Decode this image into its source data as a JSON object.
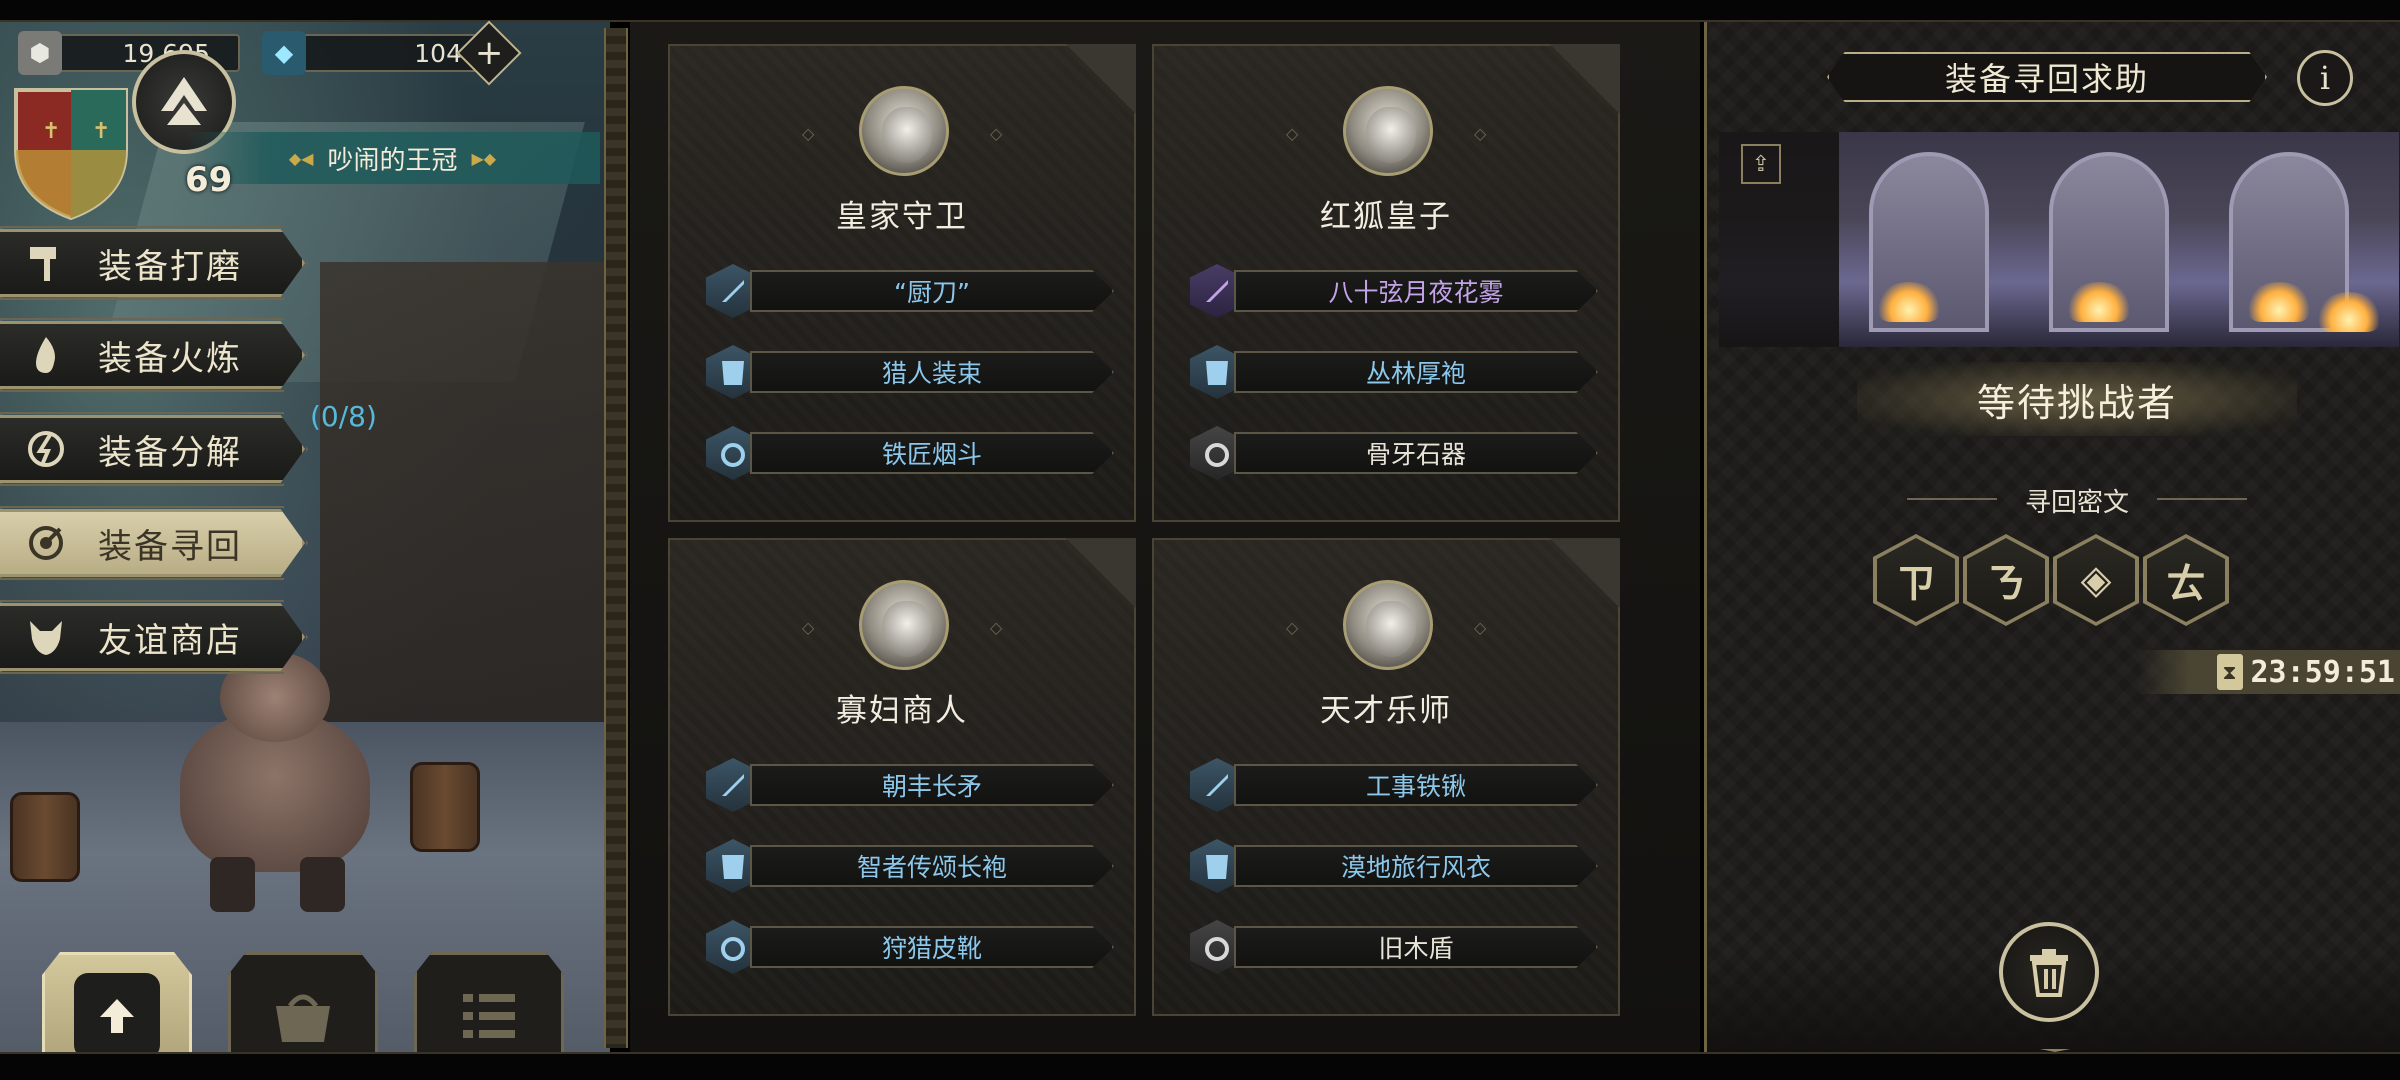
{
  "resources": {
    "stone": {
      "icon": "stone-icon",
      "value": "19,695"
    },
    "gem": {
      "icon": "gem-icon",
      "value": "104"
    }
  },
  "player": {
    "level": "69",
    "location": "吵闹的王冠"
  },
  "menu": {
    "items": [
      {
        "label": "装备打磨",
        "icon": "hammer-icon"
      },
      {
        "label": "装备火炼",
        "icon": "flame-icon"
      },
      {
        "label": "装备分解",
        "icon": "decompose-icon"
      },
      {
        "label": "装备寻回",
        "icon": "retrieve-icon"
      },
      {
        "label": "友谊商店",
        "icon": "fox-icon"
      }
    ],
    "active_index": 3,
    "decompose_count": "(0/8)"
  },
  "cards": [
    {
      "name": "皇家守卫",
      "items": [
        {
          "name": "“厨刀”",
          "slot": "sword-icon",
          "rarity": "blue"
        },
        {
          "name": "猎人装束",
          "slot": "armor-icon",
          "rarity": "blue"
        },
        {
          "name": "铁匠烟斗",
          "slot": "ring-icon",
          "rarity": "blue"
        }
      ]
    },
    {
      "name": "红狐皇子",
      "items": [
        {
          "name": "八十弦月夜花雾",
          "slot": "sword-icon",
          "rarity": "purple"
        },
        {
          "name": "丛林厚袍",
          "slot": "armor-icon",
          "rarity": "blue"
        },
        {
          "name": "骨牙石器",
          "slot": "ring-icon",
          "rarity": "white"
        }
      ]
    },
    {
      "name": "寡妇商人",
      "items": [
        {
          "name": "朝丰长矛",
          "slot": "sword-icon",
          "rarity": "blue"
        },
        {
          "name": "智者传颂长袍",
          "slot": "armor-icon",
          "rarity": "blue"
        },
        {
          "name": "狩猎皮靴",
          "slot": "ring-icon",
          "rarity": "blue"
        }
      ]
    },
    {
      "name": "天才乐师",
      "items": [
        {
          "name": "工事铁锹",
          "slot": "sword-icon",
          "rarity": "blue"
        },
        {
          "name": "漠地旅行风衣",
          "slot": "armor-icon",
          "rarity": "blue"
        },
        {
          "name": "旧木盾",
          "slot": "ring-icon",
          "rarity": "white"
        }
      ]
    }
  ],
  "panel": {
    "title": "装备寻回求助",
    "info_label": "i",
    "status": "等待挑战者",
    "cipher_title": "寻回密文",
    "runes": [
      "ㄗ",
      "ㄋ",
      "◈",
      "ㄊ"
    ],
    "timer": "23:59:51"
  },
  "colors": {
    "blue": "#8cc8ec",
    "purple": "#c3a3e8",
    "white": "#e8e4d8",
    "gold": "#c9c0a0"
  }
}
